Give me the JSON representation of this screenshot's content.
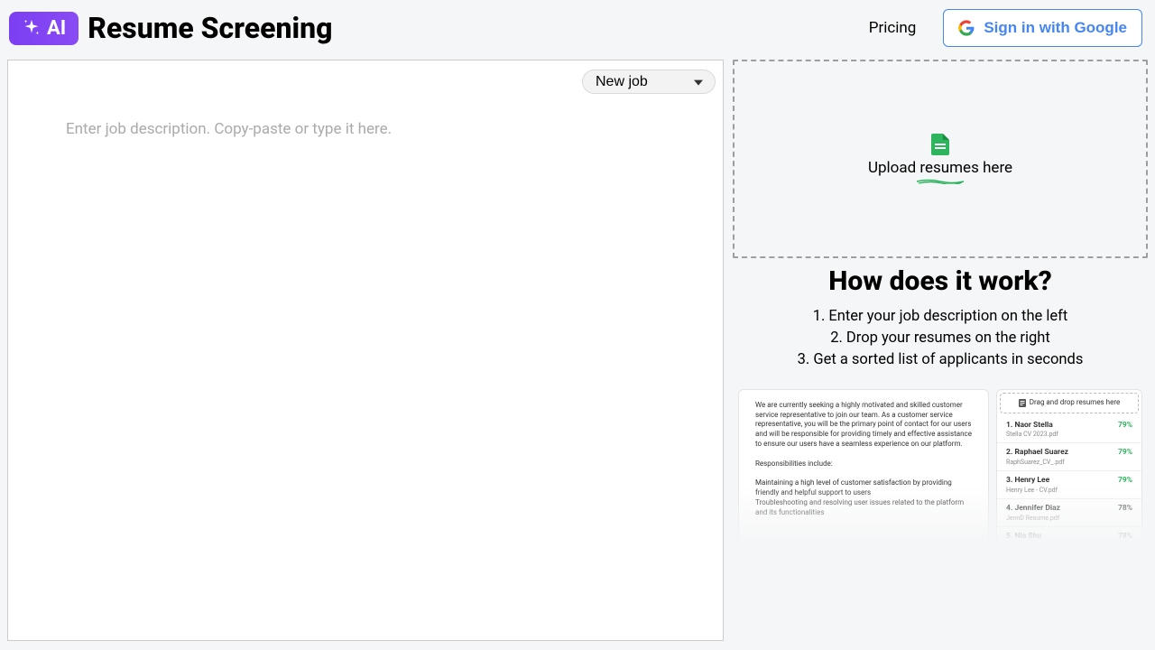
{
  "header": {
    "badge_label": "AI",
    "title": "Resume Screening",
    "pricing_label": "Pricing",
    "signin_label": "Sign in with Google"
  },
  "left": {
    "job_select_value": "New job",
    "textarea_placeholder": "Enter job description. Copy-paste or type it here."
  },
  "upload": {
    "text": "Upload resumes here"
  },
  "how": {
    "title": "How does it work?",
    "steps": [
      "1. Enter your job description on the left",
      "2. Drop your resumes on the right",
      "3. Get a sorted list of applicants in seconds"
    ]
  },
  "preview": {
    "job_desc_p1": "We are currently seeking a highly motivated and skilled customer service representative to join our team. As a customer service representative, you will be the primary point of contact for our users and will be responsible for providing timely and effective assistance to ensure our users have a seamless experience on our platform.",
    "resp_heading": "Responsibilities include:",
    "resp_1": "Maintaining a high level of customer satisfaction by providing friendly and helpful support to users",
    "resp_2": "Troubleshooting and resolving user issues related to the platform and its functionalities",
    "dnd_label": "Drag and drop resumes here",
    "results": [
      {
        "rank": "1.",
        "name": "Naor Stella",
        "file": "Stella CV 2023.pdf",
        "pct": "79%",
        "color": "green"
      },
      {
        "rank": "2.",
        "name": "Raphael Suarez",
        "file": "RaphSuarez_CV_.pdf",
        "pct": "79%",
        "color": "green"
      },
      {
        "rank": "3.",
        "name": "Henry Lee",
        "file": "Henry Lee - CV.pdf",
        "pct": "79%",
        "color": "green"
      },
      {
        "rank": "4.",
        "name": "Jennifer Diaz",
        "file": "JennD Resume.pdf",
        "pct": "78%",
        "color": "grey"
      },
      {
        "rank": "5.",
        "name": "Nia Shu",
        "file": "",
        "pct": "78%",
        "color": "grey"
      }
    ]
  }
}
